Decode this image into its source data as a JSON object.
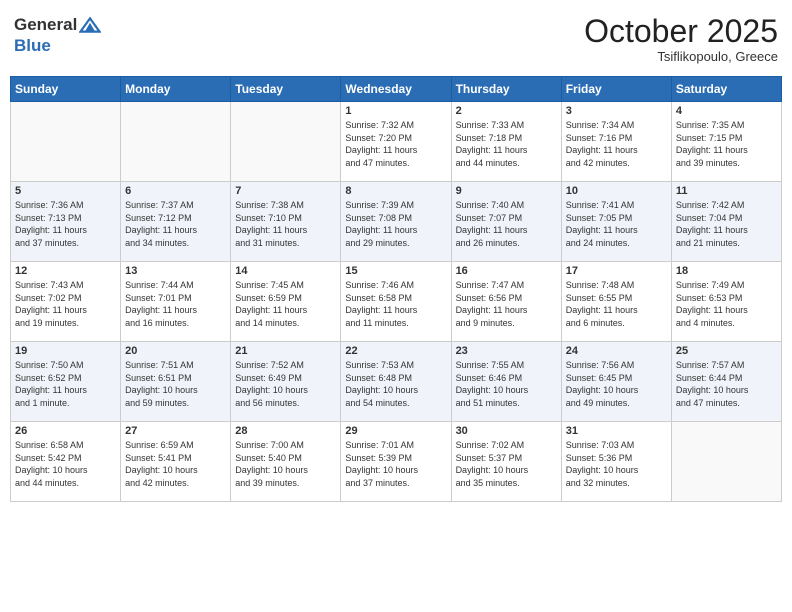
{
  "header": {
    "logo_line1": "General",
    "logo_line2": "Blue",
    "month_year": "October 2025",
    "location": "Tsiflikopoulo, Greece"
  },
  "days_of_week": [
    "Sunday",
    "Monday",
    "Tuesday",
    "Wednesday",
    "Thursday",
    "Friday",
    "Saturday"
  ],
  "weeks": [
    [
      {
        "day": "",
        "info": ""
      },
      {
        "day": "",
        "info": ""
      },
      {
        "day": "",
        "info": ""
      },
      {
        "day": "1",
        "info": "Sunrise: 7:32 AM\nSunset: 7:20 PM\nDaylight: 11 hours\nand 47 minutes."
      },
      {
        "day": "2",
        "info": "Sunrise: 7:33 AM\nSunset: 7:18 PM\nDaylight: 11 hours\nand 44 minutes."
      },
      {
        "day": "3",
        "info": "Sunrise: 7:34 AM\nSunset: 7:16 PM\nDaylight: 11 hours\nand 42 minutes."
      },
      {
        "day": "4",
        "info": "Sunrise: 7:35 AM\nSunset: 7:15 PM\nDaylight: 11 hours\nand 39 minutes."
      }
    ],
    [
      {
        "day": "5",
        "info": "Sunrise: 7:36 AM\nSunset: 7:13 PM\nDaylight: 11 hours\nand 37 minutes."
      },
      {
        "day": "6",
        "info": "Sunrise: 7:37 AM\nSunset: 7:12 PM\nDaylight: 11 hours\nand 34 minutes."
      },
      {
        "day": "7",
        "info": "Sunrise: 7:38 AM\nSunset: 7:10 PM\nDaylight: 11 hours\nand 31 minutes."
      },
      {
        "day": "8",
        "info": "Sunrise: 7:39 AM\nSunset: 7:08 PM\nDaylight: 11 hours\nand 29 minutes."
      },
      {
        "day": "9",
        "info": "Sunrise: 7:40 AM\nSunset: 7:07 PM\nDaylight: 11 hours\nand 26 minutes."
      },
      {
        "day": "10",
        "info": "Sunrise: 7:41 AM\nSunset: 7:05 PM\nDaylight: 11 hours\nand 24 minutes."
      },
      {
        "day": "11",
        "info": "Sunrise: 7:42 AM\nSunset: 7:04 PM\nDaylight: 11 hours\nand 21 minutes."
      }
    ],
    [
      {
        "day": "12",
        "info": "Sunrise: 7:43 AM\nSunset: 7:02 PM\nDaylight: 11 hours\nand 19 minutes."
      },
      {
        "day": "13",
        "info": "Sunrise: 7:44 AM\nSunset: 7:01 PM\nDaylight: 11 hours\nand 16 minutes."
      },
      {
        "day": "14",
        "info": "Sunrise: 7:45 AM\nSunset: 6:59 PM\nDaylight: 11 hours\nand 14 minutes."
      },
      {
        "day": "15",
        "info": "Sunrise: 7:46 AM\nSunset: 6:58 PM\nDaylight: 11 hours\nand 11 minutes."
      },
      {
        "day": "16",
        "info": "Sunrise: 7:47 AM\nSunset: 6:56 PM\nDaylight: 11 hours\nand 9 minutes."
      },
      {
        "day": "17",
        "info": "Sunrise: 7:48 AM\nSunset: 6:55 PM\nDaylight: 11 hours\nand 6 minutes."
      },
      {
        "day": "18",
        "info": "Sunrise: 7:49 AM\nSunset: 6:53 PM\nDaylight: 11 hours\nand 4 minutes."
      }
    ],
    [
      {
        "day": "19",
        "info": "Sunrise: 7:50 AM\nSunset: 6:52 PM\nDaylight: 11 hours\nand 1 minute."
      },
      {
        "day": "20",
        "info": "Sunrise: 7:51 AM\nSunset: 6:51 PM\nDaylight: 10 hours\nand 59 minutes."
      },
      {
        "day": "21",
        "info": "Sunrise: 7:52 AM\nSunset: 6:49 PM\nDaylight: 10 hours\nand 56 minutes."
      },
      {
        "day": "22",
        "info": "Sunrise: 7:53 AM\nSunset: 6:48 PM\nDaylight: 10 hours\nand 54 minutes."
      },
      {
        "day": "23",
        "info": "Sunrise: 7:55 AM\nSunset: 6:46 PM\nDaylight: 10 hours\nand 51 minutes."
      },
      {
        "day": "24",
        "info": "Sunrise: 7:56 AM\nSunset: 6:45 PM\nDaylight: 10 hours\nand 49 minutes."
      },
      {
        "day": "25",
        "info": "Sunrise: 7:57 AM\nSunset: 6:44 PM\nDaylight: 10 hours\nand 47 minutes."
      }
    ],
    [
      {
        "day": "26",
        "info": "Sunrise: 6:58 AM\nSunset: 5:42 PM\nDaylight: 10 hours\nand 44 minutes."
      },
      {
        "day": "27",
        "info": "Sunrise: 6:59 AM\nSunset: 5:41 PM\nDaylight: 10 hours\nand 42 minutes."
      },
      {
        "day": "28",
        "info": "Sunrise: 7:00 AM\nSunset: 5:40 PM\nDaylight: 10 hours\nand 39 minutes."
      },
      {
        "day": "29",
        "info": "Sunrise: 7:01 AM\nSunset: 5:39 PM\nDaylight: 10 hours\nand 37 minutes."
      },
      {
        "day": "30",
        "info": "Sunrise: 7:02 AM\nSunset: 5:37 PM\nDaylight: 10 hours\nand 35 minutes."
      },
      {
        "day": "31",
        "info": "Sunrise: 7:03 AM\nSunset: 5:36 PM\nDaylight: 10 hours\nand 32 minutes."
      },
      {
        "day": "",
        "info": ""
      }
    ]
  ]
}
